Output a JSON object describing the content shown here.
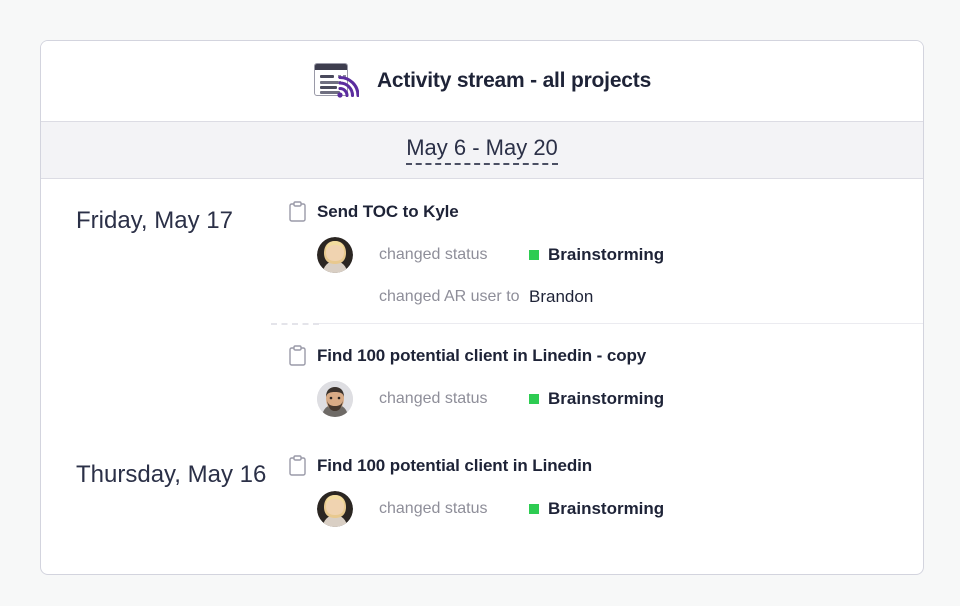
{
  "theme": {
    "page_bg": "#f7f8f8",
    "card_bg": "#ffffff",
    "card_border": "#d3d4de",
    "date_bar_bg": "#f3f3f6",
    "text_dark": "#1e2337",
    "text_muted": "#8e8e99",
    "accent_purple": "#5b2d9e",
    "status_green": "#2ecc52"
  },
  "header": {
    "icon": "activity-stream-icon",
    "title": "Activity stream - all projects"
  },
  "date_filter": {
    "icon": "date-range-selector",
    "range_label": "May 6 - May 20"
  },
  "stream": {
    "days": [
      {
        "label": "Friday, May 17",
        "entries": [
          {
            "icon": "clipboard-icon",
            "title": "Send TOC to Kyle",
            "events": [
              {
                "avatar": "avatar-female-blonde",
                "has_avatar": true,
                "action": "changed status",
                "value": "Brainstorming",
                "value_bold": true,
                "chip": "status-square",
                "chip_color": "#2ecc52"
              },
              {
                "avatar": "",
                "has_avatar": false,
                "action": "changed AR user to",
                "value": "Brandon",
                "value_bold": false,
                "chip": "",
                "chip_color": ""
              }
            ]
          },
          {
            "icon": "clipboard-icon",
            "title": "Find 100 potential client in Linedin - copy",
            "events": [
              {
                "avatar": "avatar-male-bearded",
                "has_avatar": true,
                "action": "changed status",
                "value": "Brainstorming",
                "value_bold": true,
                "chip": "status-square",
                "chip_color": "#2ecc52"
              }
            ]
          }
        ]
      },
      {
        "label": "Thursday, May 16",
        "entries": [
          {
            "icon": "clipboard-icon",
            "title": "Find 100 potential client in Linedin",
            "events": [
              {
                "avatar": "avatar-female-blonde",
                "has_avatar": true,
                "action": "changed status",
                "value": "Brainstorming",
                "value_bold": true,
                "chip": "status-square",
                "chip_color": "#2ecc52"
              }
            ]
          }
        ]
      }
    ]
  }
}
